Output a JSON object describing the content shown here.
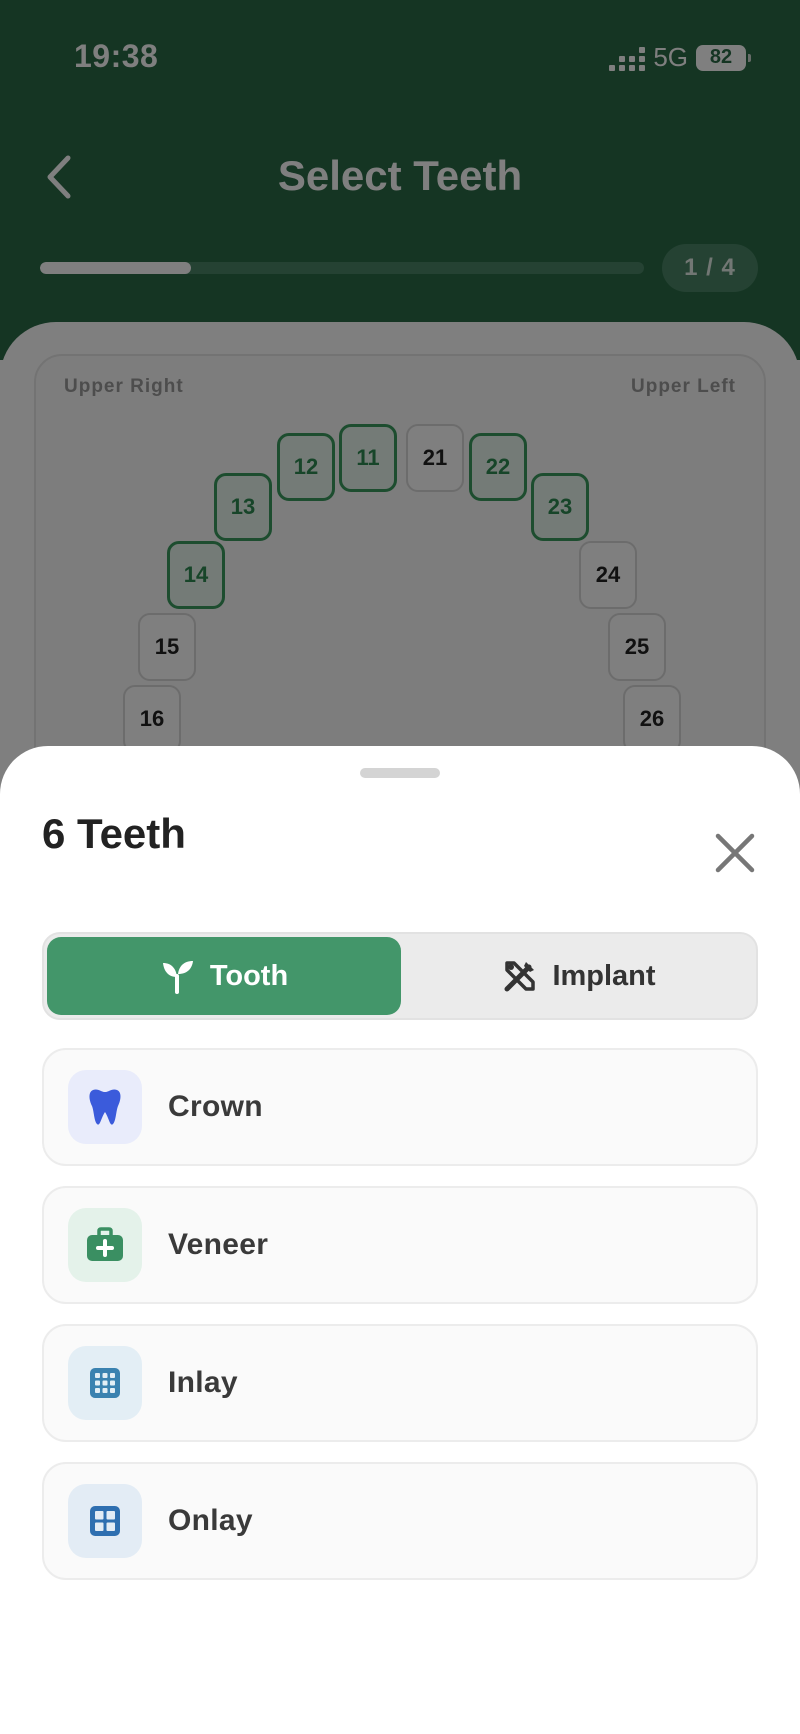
{
  "status_bar": {
    "time": "19:38",
    "network": "5G",
    "battery": "82"
  },
  "header": {
    "title": "Select Teeth",
    "step": "1 / 4",
    "progress": 0.25
  },
  "chart": {
    "upper_right_label": "Upper Right",
    "upper_left_label": "Upper Left",
    "teeth": [
      {
        "number": "11",
        "selected": true
      },
      {
        "number": "12",
        "selected": true
      },
      {
        "number": "13",
        "selected": true
      },
      {
        "number": "14",
        "selected": true
      },
      {
        "number": "15",
        "selected": false
      },
      {
        "number": "16",
        "selected": false
      },
      {
        "number": "21",
        "selected": false
      },
      {
        "number": "22",
        "selected": true
      },
      {
        "number": "23",
        "selected": true
      },
      {
        "number": "24",
        "selected": false
      },
      {
        "number": "25",
        "selected": false
      },
      {
        "number": "26",
        "selected": false
      }
    ]
  },
  "sheet": {
    "title": "6 Teeth",
    "segments": [
      {
        "label": "Tooth",
        "icon": "sprout-icon",
        "active": true
      },
      {
        "label": "Implant",
        "icon": "tools-icon",
        "active": false
      }
    ],
    "options": [
      {
        "label": "Crown",
        "icon": "tooth-icon",
        "icon_color": "#3b5bdb",
        "icon_bg": "#e9ecfb"
      },
      {
        "label": "Veneer",
        "icon": "medkit-icon",
        "icon_color": "#3a8f62",
        "icon_bg": "#e4f2ea"
      },
      {
        "label": "Inlay",
        "icon": "grid-icon",
        "icon_color": "#3b82b0",
        "icon_bg": "#e3eef5"
      },
      {
        "label": "Onlay",
        "icon": "quad-grid-icon",
        "icon_color": "#2f6fb0",
        "icon_bg": "#e3ecf5"
      }
    ]
  },
  "colors": {
    "header_green": "#2b6b47",
    "accent_green": "#43966a",
    "selected_tooth": "#3a9a5e"
  }
}
